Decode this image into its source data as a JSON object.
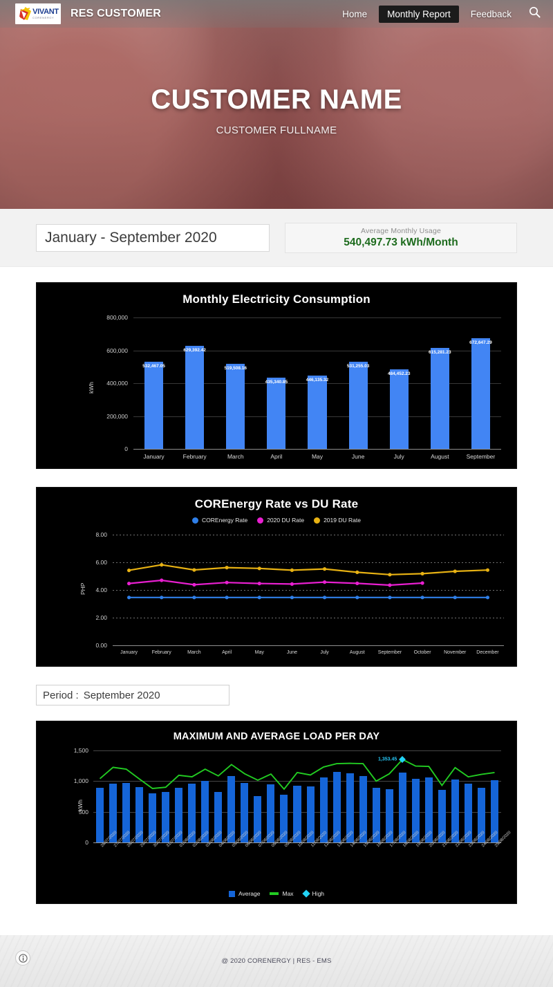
{
  "nav": {
    "brand": "RES CUSTOMER",
    "logo": {
      "name": "VIVANT",
      "sub": "CORENERGY"
    },
    "links": [
      {
        "label": "Home",
        "active": false
      },
      {
        "label": "Monthly Report",
        "active": true
      },
      {
        "label": "Feedback",
        "active": false
      }
    ],
    "search_icon": "search-icon"
  },
  "hero": {
    "title": "CUSTOMER NAME",
    "subtitle": "CUSTOMER FULLNAME"
  },
  "summary": {
    "period": "January - September 2020",
    "average_label": "Average  Monthly Usage",
    "average_value": "540,497.73 kWh/Month"
  },
  "period_picker": {
    "label": "Period :",
    "value": "September 2020"
  },
  "footer": {
    "text": "@ 2020 CORENERGY | RES - EMS",
    "info_icon": "info-icon"
  },
  "colors": {
    "bar_blue": "#4285f4",
    "bar_blue_dark": "#1565d8",
    "line_blue": "#2f7fe8",
    "line_magenta": "#e91fd1",
    "line_amber": "#e8b213",
    "line_green": "#22cc22",
    "high_cyan": "#22d3f5",
    "accent_green": "#1d6b1d",
    "chart_bg": "#000000"
  },
  "chart_data": [
    {
      "id": "monthly-consumption",
      "type": "bar",
      "title": "Monthly Electricity Consumption",
      "xlabel": "",
      "ylabel": "kWh",
      "ylim": [
        0,
        800000
      ],
      "yticks": [
        "0",
        "200,000",
        "400,000",
        "600,000",
        "800,000"
      ],
      "ytick_values": [
        0,
        200000,
        400000,
        600000,
        800000
      ],
      "grid": true,
      "categories": [
        "January",
        "February",
        "March",
        "April",
        "May",
        "June",
        "July",
        "August",
        "September"
      ],
      "values": [
        532467.05,
        629392.42,
        519508.16,
        435340.85,
        446135.32,
        531255.03,
        484452.23,
        615281.23,
        672647.29
      ],
      "data_labels": [
        "532,467.05",
        "629,392.42",
        "519,508.16",
        "435,340.85",
        "446,135.32",
        "531,255.03",
        "484,452.23",
        "615,281.23",
        "672,647.29"
      ]
    },
    {
      "id": "corenergy-vs-du-rate",
      "type": "line",
      "title": "COREnergy Rate vs DU Rate",
      "xlabel": "",
      "ylabel": "PHP",
      "ylim": [
        0,
        8
      ],
      "yticks": [
        "0.00",
        "2.00",
        "4.00",
        "6.00",
        "8.00"
      ],
      "ytick_values": [
        0,
        2,
        4,
        6,
        8
      ],
      "grid": true,
      "legend_position": "top",
      "categories": [
        "January",
        "February",
        "March",
        "April",
        "May",
        "June",
        "July",
        "August",
        "September",
        "October",
        "November",
        "December"
      ],
      "series": [
        {
          "name": "COREnergy Rate",
          "color": "#2f7fe8",
          "values": [
            3.46,
            3.46,
            3.46,
            3.46,
            3.46,
            3.46,
            3.46,
            3.46,
            3.46,
            3.46,
            3.46,
            3.46
          ]
        },
        {
          "name": "2020 DU Rate",
          "color": "#e91fd1",
          "values": [
            4.47,
            4.7,
            4.38,
            4.54,
            4.47,
            4.43,
            4.57,
            4.48,
            4.35,
            4.5,
            null,
            null
          ]
        },
        {
          "name": "2019 DU Rate",
          "color": "#e8b213",
          "values": [
            5.42,
            5.82,
            5.45,
            5.62,
            5.56,
            5.43,
            5.52,
            5.28,
            5.11,
            5.18,
            5.35,
            5.44
          ]
        }
      ]
    },
    {
      "id": "max-average-load-per-day",
      "type": "bar+line",
      "title": "MAXIMUM AND AVERAGE LOAD PER DAY",
      "xlabel": "",
      "ylabel": "kWh",
      "ylim": [
        0,
        1500
      ],
      "yticks": [
        "0",
        "500",
        "1,000",
        "1,500"
      ],
      "ytick_values": [
        0,
        500,
        1000,
        1500
      ],
      "grid": true,
      "legend_position": "bottom",
      "legend": [
        {
          "name": "Average",
          "marker": "square",
          "color": "#1565d8"
        },
        {
          "name": "Max",
          "marker": "line",
          "color": "#22cc22"
        },
        {
          "name": "High",
          "marker": "diamond",
          "color": "#22d3f5"
        }
      ],
      "categories": [
        "26/07/2020",
        "27/07/2020",
        "28/07/2020",
        "29/07/2020",
        "30/07/2020",
        "31/07/2020",
        "01/08/2020",
        "02/08/2020",
        "03/08/2020",
        "04/08/2020",
        "05/08/2020",
        "06/08/2020",
        "07/08/2020",
        "08/08/2020",
        "09/08/2020",
        "10/08/2020",
        "11/08/2020",
        "12/08/2020",
        "13/08/2020",
        "14/08/2020",
        "15/08/2020",
        "16/08/2020",
        "17/08/2020",
        "18/08/2020",
        "19/08/2020",
        "20/08/2020",
        "21/08/2020",
        "22/08/2020",
        "23/08/2020",
        "24/08/2020",
        "25/08/2020"
      ],
      "series": [
        {
          "name": "Average",
          "type": "bar",
          "color": "#1565d8",
          "values": [
            895,
            958,
            965,
            905,
            800,
            825,
            890,
            960,
            1005,
            820,
            1085,
            965,
            760,
            950,
            780,
            925,
            915,
            1060,
            1155,
            1125,
            1085,
            895,
            870,
            1140,
            1040,
            1065,
            860,
            1025,
            955,
            895,
            1010
          ]
        },
        {
          "name": "Max",
          "type": "line",
          "color": "#22cc22",
          "values": [
            1040,
            1225,
            1195,
            1035,
            880,
            900,
            1095,
            1070,
            1195,
            1085,
            1270,
            1120,
            1015,
            1115,
            870,
            1140,
            1100,
            1230,
            1285,
            1290,
            1285,
            1000,
            1120,
            1353.45,
            1245,
            1240,
            930,
            1220,
            1070,
            1110,
            1140
          ]
        }
      ],
      "annotations": [
        {
          "label": "1,353.45",
          "category": "18/08/2020",
          "value": 1353.45,
          "marker": "high-diamond",
          "color": "#22d3f5"
        }
      ]
    }
  ]
}
